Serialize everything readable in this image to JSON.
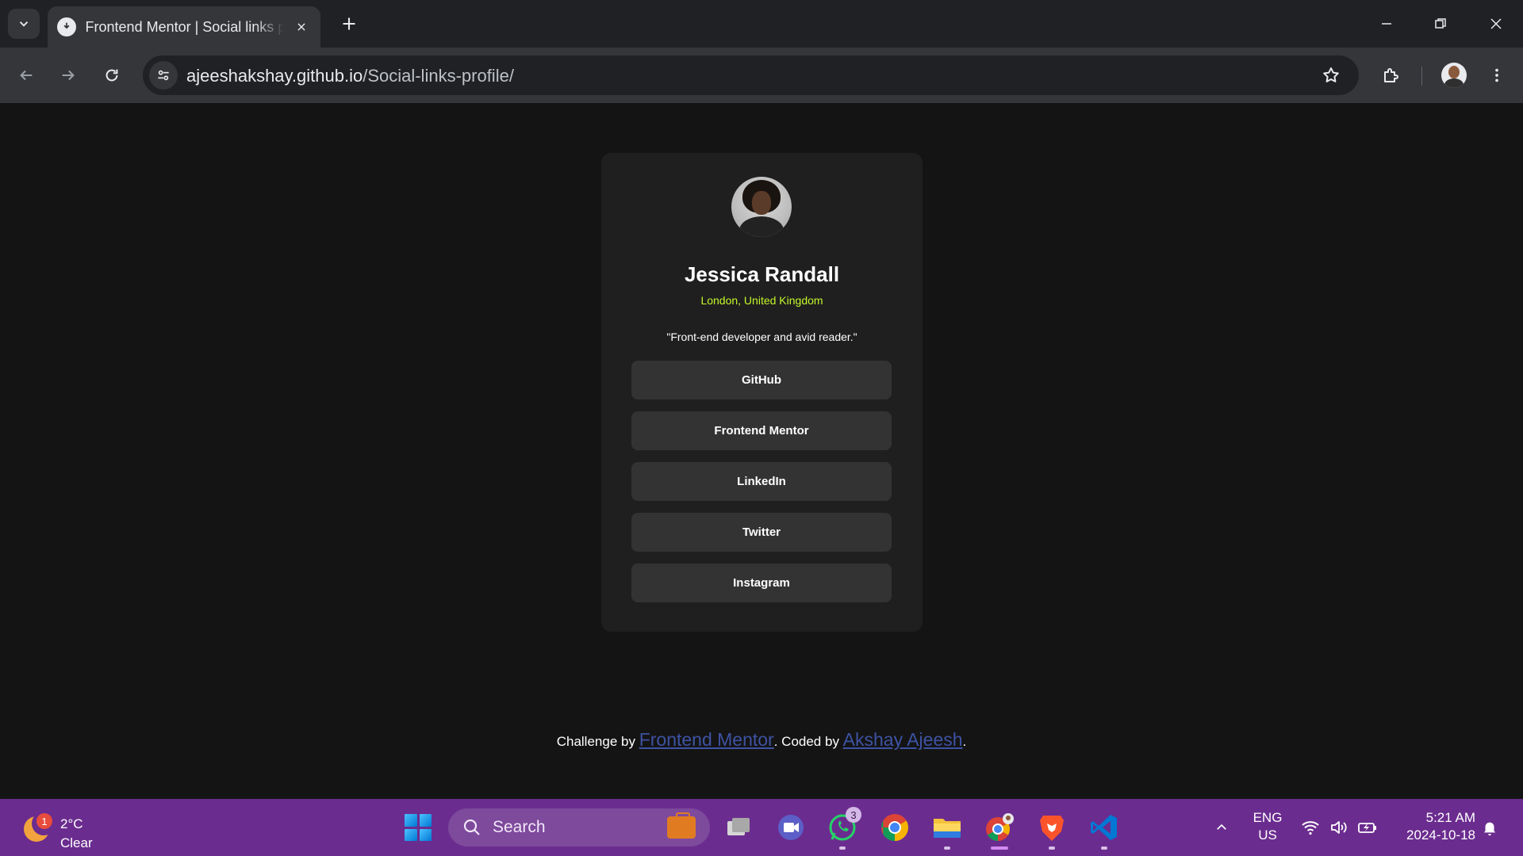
{
  "browser": {
    "tab_title": "Frontend Mentor | Social links profile",
    "url_host": "ajeeshakshay.github.io",
    "url_path": "/Social-links-profile/"
  },
  "profile": {
    "name": "Jessica Randall",
    "location": "London, United Kingdom",
    "bio": "\"Front-end developer and avid reader.\"",
    "links": [
      "GitHub",
      "Frontend Mentor",
      "LinkedIn",
      "Twitter",
      "Instagram"
    ]
  },
  "footer": {
    "prefix": "Challenge by ",
    "link1": "Frontend Mentor",
    "middle": ". Coded by ",
    "link2": "Akshay Ajeesh",
    "suffix": "."
  },
  "taskbar": {
    "weather_badge": "1",
    "weather_temp": "2°C",
    "weather_condition": "Clear",
    "search_label": "Search",
    "whatsapp_badge": "3",
    "lang_top": "ENG",
    "lang_bottom": "US",
    "time": "5:21 AM",
    "date": "2024-10-18"
  },
  "colors": {
    "page_bg": "#141414",
    "card_bg": "#1f1f1f",
    "button_bg": "#333333",
    "accent_green": "#c4f82a",
    "taskbar": "#6b2c8f",
    "link_blue": "#3e52a3"
  }
}
